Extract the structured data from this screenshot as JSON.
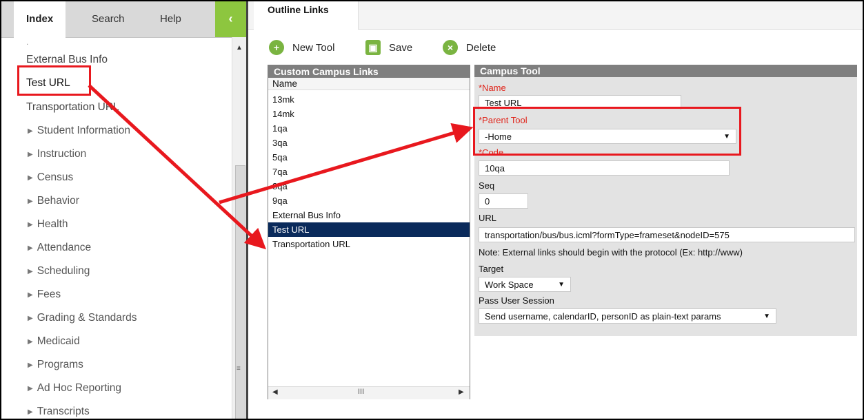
{
  "sidebar": {
    "tabs": [
      {
        "label": "Index"
      },
      {
        "label": "Search"
      },
      {
        "label": "Help"
      }
    ],
    "collapse_icon": "chevron-left-icon",
    "links": [
      "External Bus Info",
      "Test URL",
      "Transportation URL"
    ],
    "folders": [
      "Student Information",
      "Instruction",
      "Census",
      "Behavior",
      "Health",
      "Attendance",
      "Scheduling",
      "Fees",
      "Grading & Standards",
      "Medicaid",
      "Programs",
      "Ad Hoc Reporting",
      "Transcripts"
    ]
  },
  "main": {
    "tab_label": "Outline Links",
    "toolbar": {
      "new_label": "New Tool",
      "save_label": "Save",
      "delete_label": "Delete"
    },
    "links_panel": {
      "title": "Custom Campus Links",
      "column_header": "Name",
      "items": [
        "13mk",
        "14mk",
        "1qa",
        "3qa",
        "5qa",
        "7qa",
        "8qa",
        "9qa",
        "External Bus Info",
        "Test URL",
        "Transportation URL"
      ],
      "selected": "Test URL"
    },
    "tool_panel": {
      "title": "Campus Tool",
      "name_label": "*Name",
      "name_value": "Test URL",
      "parent_label": "*Parent Tool",
      "parent_value": "-Home",
      "code_label": "*Code",
      "code_value": "10qa",
      "seq_label": "Seq",
      "seq_value": "0",
      "url_label": "URL",
      "url_value": "transportation/bus/bus.icml?formType=frameset&nodeID=575",
      "note": "Note: External links should begin with the protocol (Ex: http://www)",
      "target_label": "Target",
      "target_value": "Work Space",
      "session_label": "Pass User Session",
      "session_value": "Send username, calendarID, personID as plain-text params"
    }
  },
  "colors": {
    "accent_green": "#8dc63f",
    "selection": "#0a2a5b",
    "annotation_red": "#e8181e",
    "panel_header": "#7f7f7f"
  }
}
